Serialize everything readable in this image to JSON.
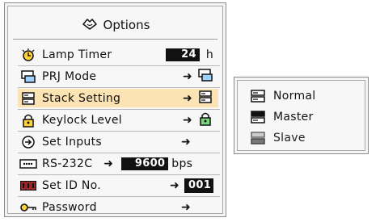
{
  "panel": {
    "title": "Options",
    "title_icon": "options-icon"
  },
  "menu": {
    "lamp_timer": {
      "label": "Lamp Timer",
      "value": "24",
      "unit": "h",
      "icon": "lamp-timer-icon"
    },
    "prj_mode": {
      "label": "PRJ Mode",
      "icon": "prj-mode-icon"
    },
    "stack_setting": {
      "label": "Stack Setting",
      "icon": "stack-icon",
      "highlight": "#fbe3b4"
    },
    "keylock": {
      "label": "Keylock Level",
      "icon": "lock-icon"
    },
    "set_inputs": {
      "label": "Set Inputs",
      "icon": "set-inputs-icon"
    },
    "rs232c": {
      "label": "RS-232C",
      "value": "9600",
      "unit": "bps",
      "icon": "rs232c-icon"
    },
    "set_id": {
      "label": "Set ID No.",
      "value": "001",
      "icon": "id-icon"
    },
    "password": {
      "label": "Password",
      "icon": "key-icon"
    }
  },
  "submenu": {
    "items": [
      {
        "label": "Normal",
        "icon": "stack-normal-icon"
      },
      {
        "label": "Master",
        "icon": "stack-master-icon"
      },
      {
        "label": "Slave",
        "icon": "stack-slave-icon"
      }
    ]
  }
}
